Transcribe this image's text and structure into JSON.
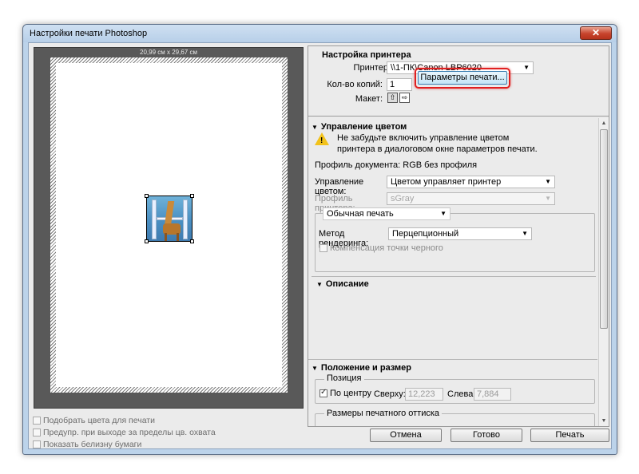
{
  "window": {
    "title": "Настройки печати Photoshop",
    "close_glyph": "✕"
  },
  "preview": {
    "dimensions_label": "20,99 см x 29,67 см",
    "options": [
      {
        "label": "Подобрать цвета для печати",
        "checked": false
      },
      {
        "label": "Предупр. при выходе за пределы цв. охвата",
        "checked": false
      },
      {
        "label": "Показать белизну бумаги",
        "checked": false
      }
    ]
  },
  "printer_setup": {
    "heading": "Настройка принтера",
    "printer_label": "Принтер:",
    "printer_value": "\\\\1-ПК\\Canon LBP6020",
    "copies_label": "Кол-во копий:",
    "copies_value": "1",
    "print_settings_button": "Параметры печати...",
    "layout_label": "Макет:",
    "layout_icons": [
      "portrait-icon",
      "landscape-icon"
    ]
  },
  "color_management": {
    "heading": "Управление цветом",
    "warning_text_1": "Не забудьте включить управление цветом",
    "warning_text_2": "принтера в диалоговом окне параметров печати.",
    "document_profile": "Профиль документа: RGB без профиля",
    "color_handling_label": "Управление цветом:",
    "color_handling_value": "Цветом управляет принтер",
    "printer_profile_label": "Профиль принтера:",
    "printer_profile_value": "sGray",
    "print_mode_value": "Обычная печать",
    "rendering_label": "Метод рендеринга:",
    "rendering_value": "Перцепционный",
    "black_point_label": "Компенсация точки черного",
    "black_point_checked": false
  },
  "description": {
    "heading": "Описание"
  },
  "position_size": {
    "heading": "Положение и размер",
    "position_group": "Позиция",
    "center_label": "По центру",
    "center_checked": true,
    "top_label": "Сверху:",
    "top_value": "12,223",
    "left_label": "Слева:",
    "left_value": "7,884",
    "print_size_group": "Размеры печатного оттиска"
  },
  "footer": {
    "cancel_button": "Отмена",
    "done_button": "Готово",
    "print_button": "Печать"
  },
  "colors": {
    "highlight_ring": "#e02020",
    "warning": "#f2c21b"
  }
}
